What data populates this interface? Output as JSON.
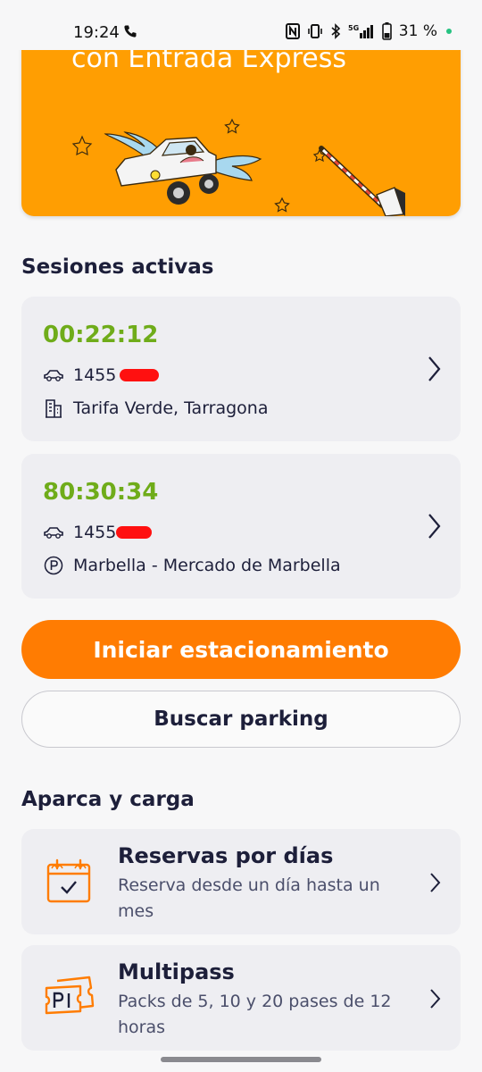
{
  "status_bar": {
    "time": "19:24",
    "battery": "31 %",
    "network": "5G"
  },
  "banner": {
    "title": "con Entrada Express"
  },
  "active_sessions": {
    "title": "Sesiones activas",
    "sessions": [
      {
        "timer": "00:22:12",
        "plate": "1455",
        "location": "Tarifa Verde, Tarragona",
        "location_icon": "building-icon"
      },
      {
        "timer": "80:30:34",
        "plate": "1455",
        "location": "Marbella - Mercado de Marbella",
        "location_icon": "parking-icon"
      }
    ]
  },
  "actions": {
    "start_parking": "Iniciar estacionamiento",
    "search_parking": "Buscar parking"
  },
  "park_and_charge": {
    "title": "Aparca y carga",
    "items": [
      {
        "title": "Reservas por días",
        "subtitle": "Reserva desde un día hasta un mes",
        "icon": "calendar-check-icon"
      },
      {
        "title": "Multipass",
        "subtitle": "Packs de 5, 10 y 20 pases de 12 horas",
        "icon": "ticket-icon"
      }
    ]
  },
  "colors": {
    "primary_orange": "#ff7c02",
    "banner_orange": "#ff9e02",
    "timer_green": "#6fac1a",
    "card_bg": "#eeeef2",
    "text_dark": "#1d1f3a"
  }
}
